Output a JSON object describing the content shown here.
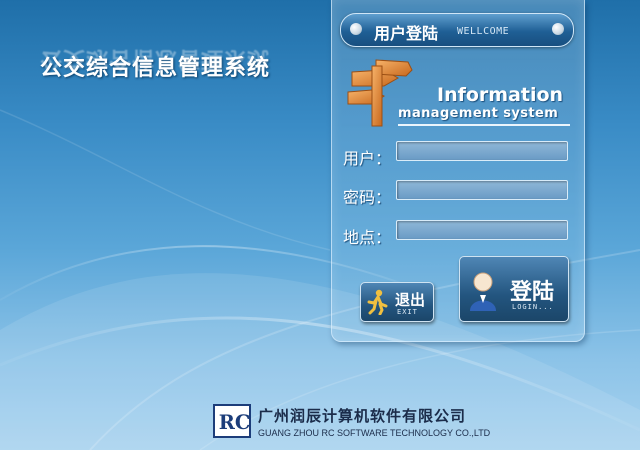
{
  "app": {
    "title": "公交综合信息管理系统"
  },
  "panel": {
    "header_title": "用户登陆",
    "header_subtitle": "WELLCOME",
    "info_line1": "Information",
    "info_line2": "management system"
  },
  "form": {
    "user_label": "用户：",
    "password_label": "密码：",
    "location_label": "地点：",
    "user_value": "",
    "password_value": "",
    "location_value": ""
  },
  "buttons": {
    "exit_label": "退出",
    "exit_sub": "EXIT",
    "login_label": "登陆",
    "login_sub": "LOGIN..."
  },
  "footer": {
    "company_cn": "广州润辰计算机软件有限公司",
    "company_en": "GUANG ZHOU RC SOFTWARE TECHNOLOGY CO.,LTD",
    "logo_text": "RC"
  },
  "colors": {
    "background_top": "#1f6fa9",
    "background_bottom": "#a9d3ef",
    "panel_header": "#1f5f95",
    "logo_orange": "#e08a2e",
    "company_text": "#1b2c4a"
  },
  "icons": {
    "header_dots": "circle",
    "exit": "running-person-icon",
    "login": "user-avatar-icon",
    "brand": "signpost-arrow-logo"
  }
}
